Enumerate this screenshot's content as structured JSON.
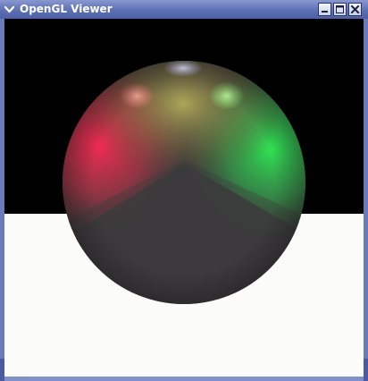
{
  "window": {
    "title": "OpenGL Viewer",
    "icons": {
      "menu": "chevron-down-icon",
      "minimize": "minimize-icon",
      "maximize": "maximize-icon",
      "close": "close-icon"
    }
  },
  "scene": {
    "background_top": "#000000",
    "background_bottom": "#fbfcfa",
    "sphere_base": "#3c3b3c",
    "light_colors": {
      "red": "#ff3060",
      "green": "#30e060",
      "white": "#e8e8ff"
    }
  }
}
